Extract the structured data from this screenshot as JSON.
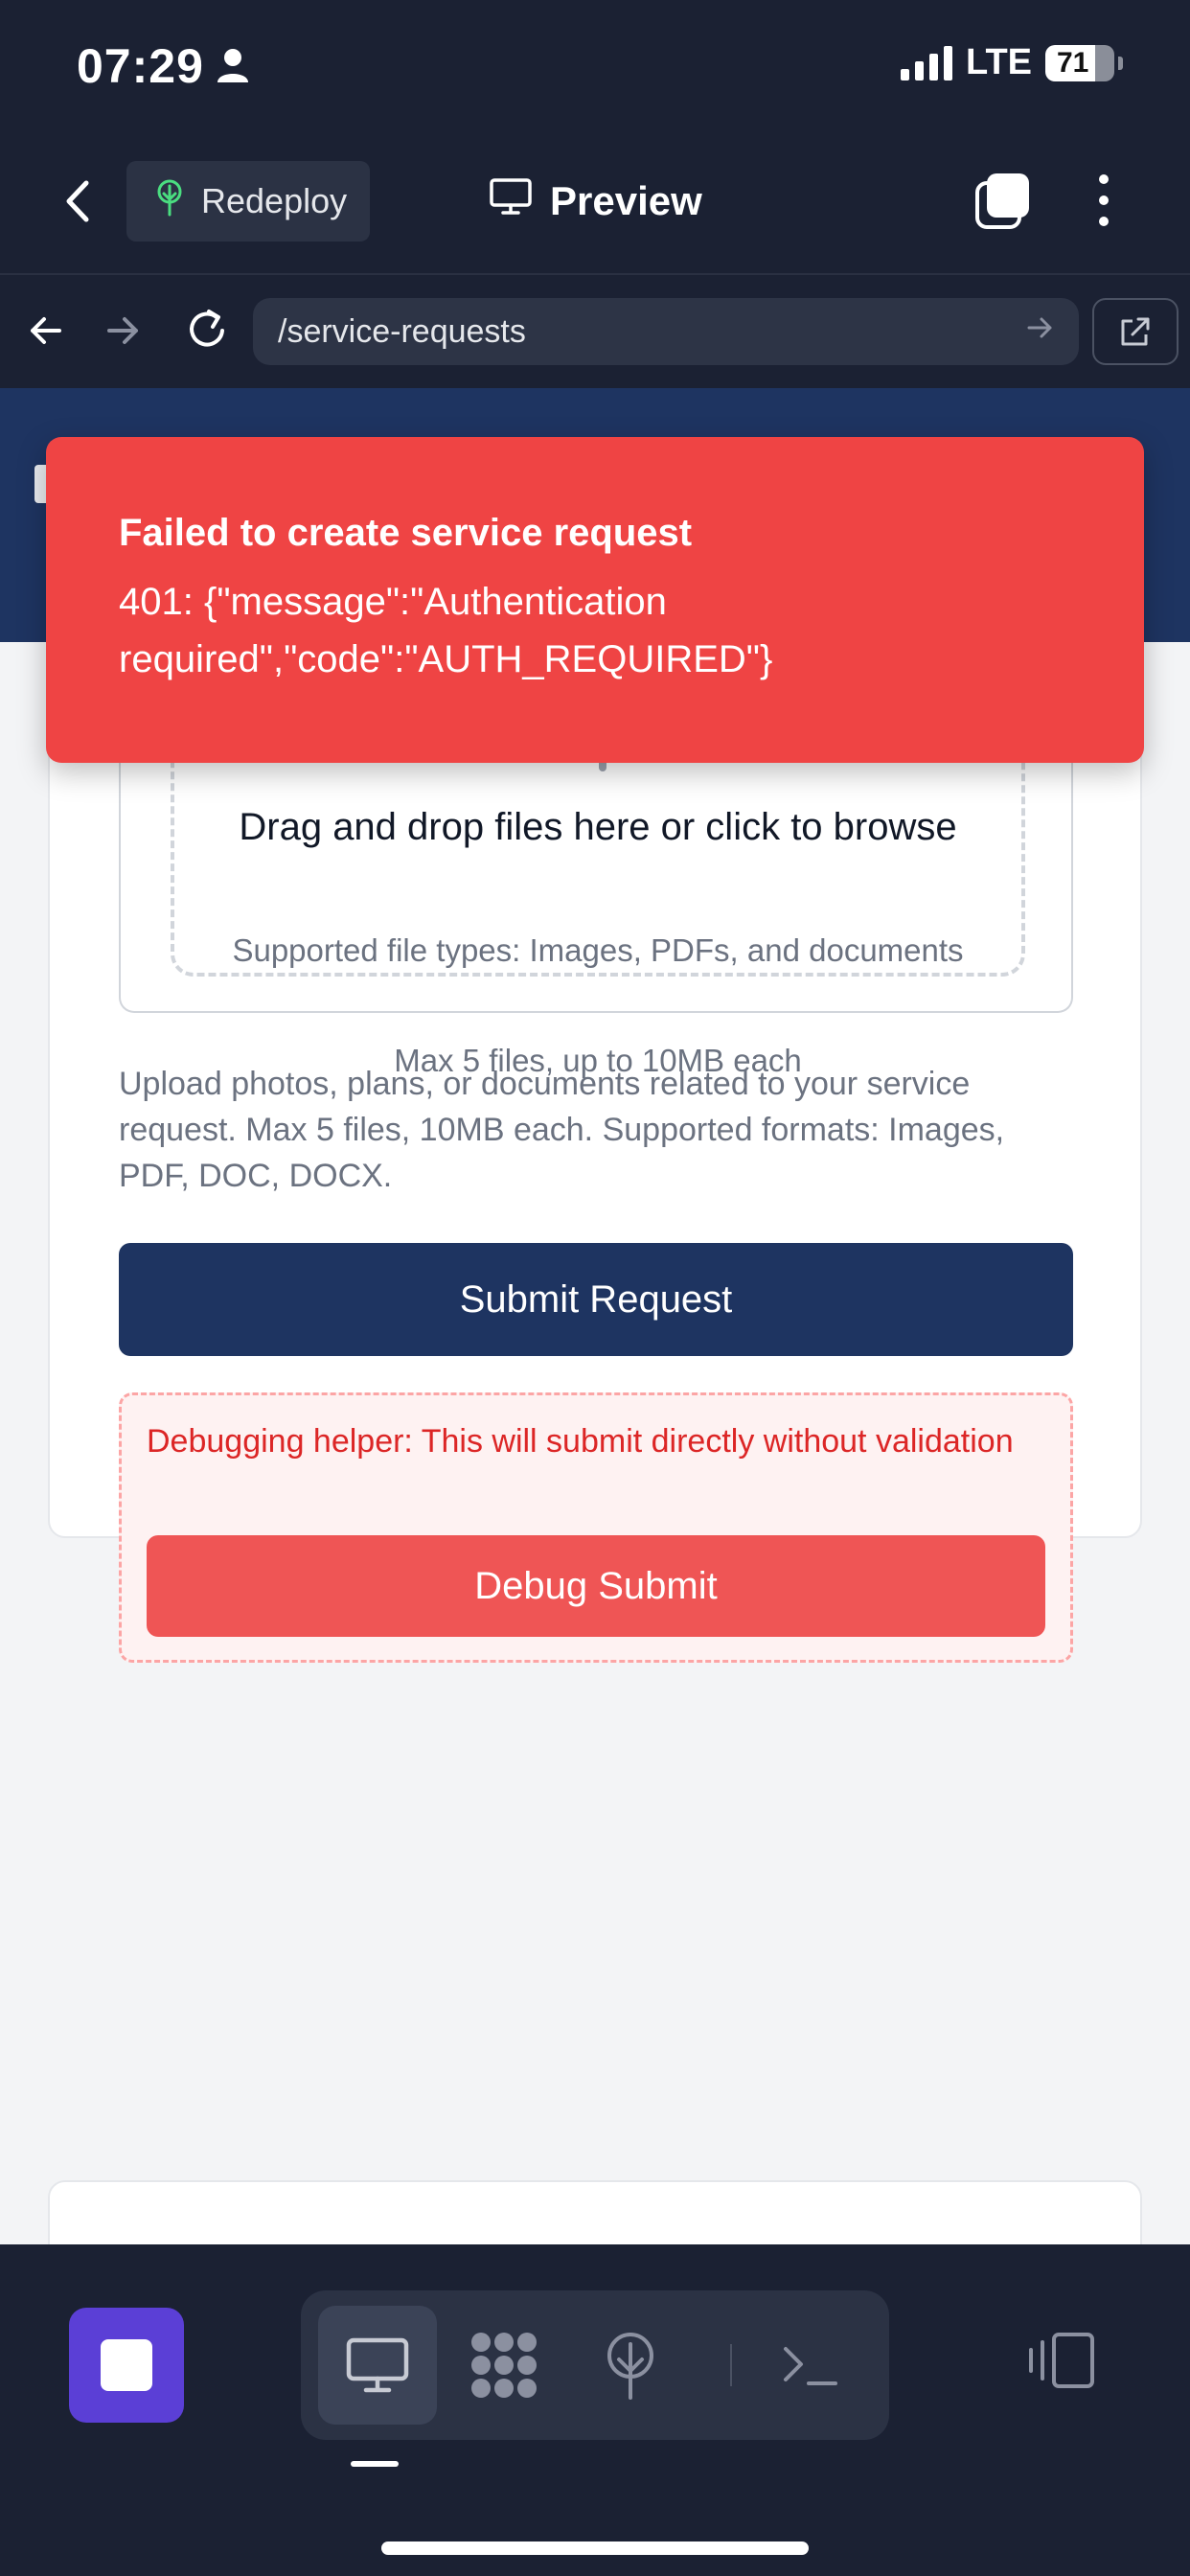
{
  "status_bar": {
    "time": "07:29",
    "network": "LTE",
    "battery": "71",
    "battery_level_percent": 71
  },
  "toolbar": {
    "redeploy_label": "Redeploy",
    "preview_label": "Preview"
  },
  "browser": {
    "url": "/service-requests"
  },
  "toast": {
    "title": "Failed to create service request",
    "message": "401: {\"message\":\"Authentication required\",\"code\":\"AUTH_REQUIRED\"}",
    "color": "#ef4444"
  },
  "upload": {
    "drop_title": "Drag and drop files here or click to browse",
    "supported_types": "Supported file types: Images, PDFs, and documents",
    "limit": "Max 5 files, up to 10MB each"
  },
  "form": {
    "help_text": "Upload photos, plans, or documents related to your service request. Max 5 files, 10MB each. Supported formats: Images, PDF, DOC, DOCX.",
    "submit_label": "Submit Request",
    "debug_text": "Debugging helper: This will submit directly without validation",
    "debug_submit_label": "Debug Submit"
  },
  "colors": {
    "app_background": "#1b2133",
    "primary": "#1e3461",
    "stop_button": "#5b3fd6",
    "debug_button": "#ef5555"
  },
  "icons": [
    "person-icon",
    "back-chevron-icon",
    "tree-icon",
    "monitor-icon",
    "copy-icon",
    "more-vertical-icon",
    "arrow-left-icon",
    "arrow-right-icon",
    "reload-icon",
    "external-link-icon",
    "upload-cloud-icon",
    "stop-icon",
    "grid-icon",
    "deploy-icon",
    "terminal-icon",
    "panel-toggle-icon"
  ]
}
